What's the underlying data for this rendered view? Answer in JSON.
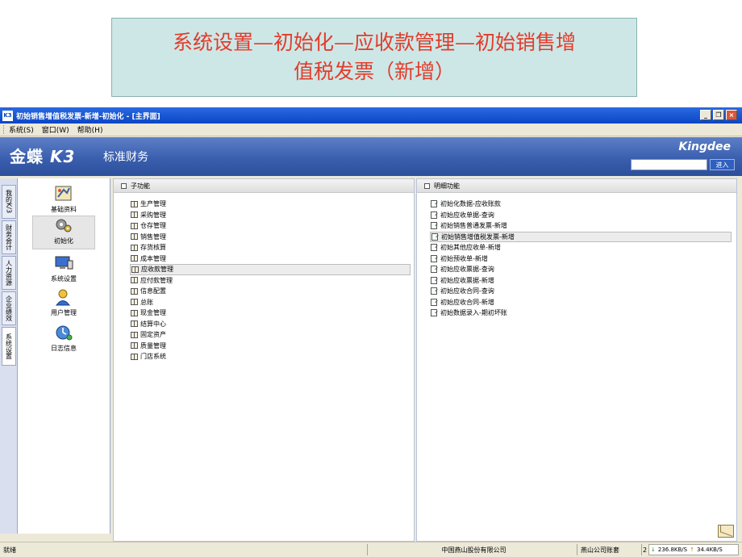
{
  "slide": {
    "title_line1": "系统设置—初始化—应收款管理—初始销售增",
    "title_line2": "值税发票（新增）"
  },
  "window": {
    "title": "初始销售增值税发票-新增-初始化 - [主界面]",
    "app_icon": "K3",
    "minimize": "_",
    "restore": "❐",
    "close": "×"
  },
  "menu": {
    "items": [
      "系统(S)",
      "窗口(W)",
      "帮助(H)"
    ]
  },
  "header": {
    "brand": "金蝶",
    "brand_k3": "K3",
    "subtitle": "标准财务",
    "logo": "Kingdee",
    "search_placeholder": "",
    "enter_label": "进入"
  },
  "vtabs": [
    "我的K/3",
    "财务会计",
    "人力资源",
    "企业绩效",
    "系统设置"
  ],
  "nav": [
    {
      "label": "基础资料",
      "icon": "settings-form-icon"
    },
    {
      "label": "初始化",
      "icon": "gears-icon"
    },
    {
      "label": "系统设置",
      "icon": "monitor-icon"
    },
    {
      "label": "用户管理",
      "icon": "user-icon"
    },
    {
      "label": "日志信息",
      "icon": "globe-clock-icon"
    }
  ],
  "left_panel": {
    "header": "子功能",
    "items": [
      "生产管理",
      "采购管理",
      "仓存管理",
      "销售管理",
      "存货核算",
      "成本管理",
      "应收款管理",
      "应付款管理",
      "信息配置",
      "总账",
      "现金管理",
      "结算中心",
      "固定资产",
      "质量管理",
      "门店系统"
    ],
    "selected_index": 6
  },
  "right_panel": {
    "header": "明细功能",
    "items": [
      "初始化数据-应收账款",
      "初始应收单据-查询",
      "初始销售普通发票-新增",
      "初始销售增值税发票-新增",
      "初始其他应收单-新增",
      "初始预收单-新增",
      "初始应收票据-查询",
      "初始应收票据-新增",
      "初始应收合同-查询",
      "初始应收合同-新增",
      "初始数据录入-期初坏账"
    ],
    "selected_index": 3
  },
  "status": {
    "ready": "就绪",
    "company": "中国燕山股份有限公司",
    "account": "燕山公司账套",
    "extra": "2",
    "download": "236.8KB/S",
    "upload": "34.4KB/S"
  }
}
